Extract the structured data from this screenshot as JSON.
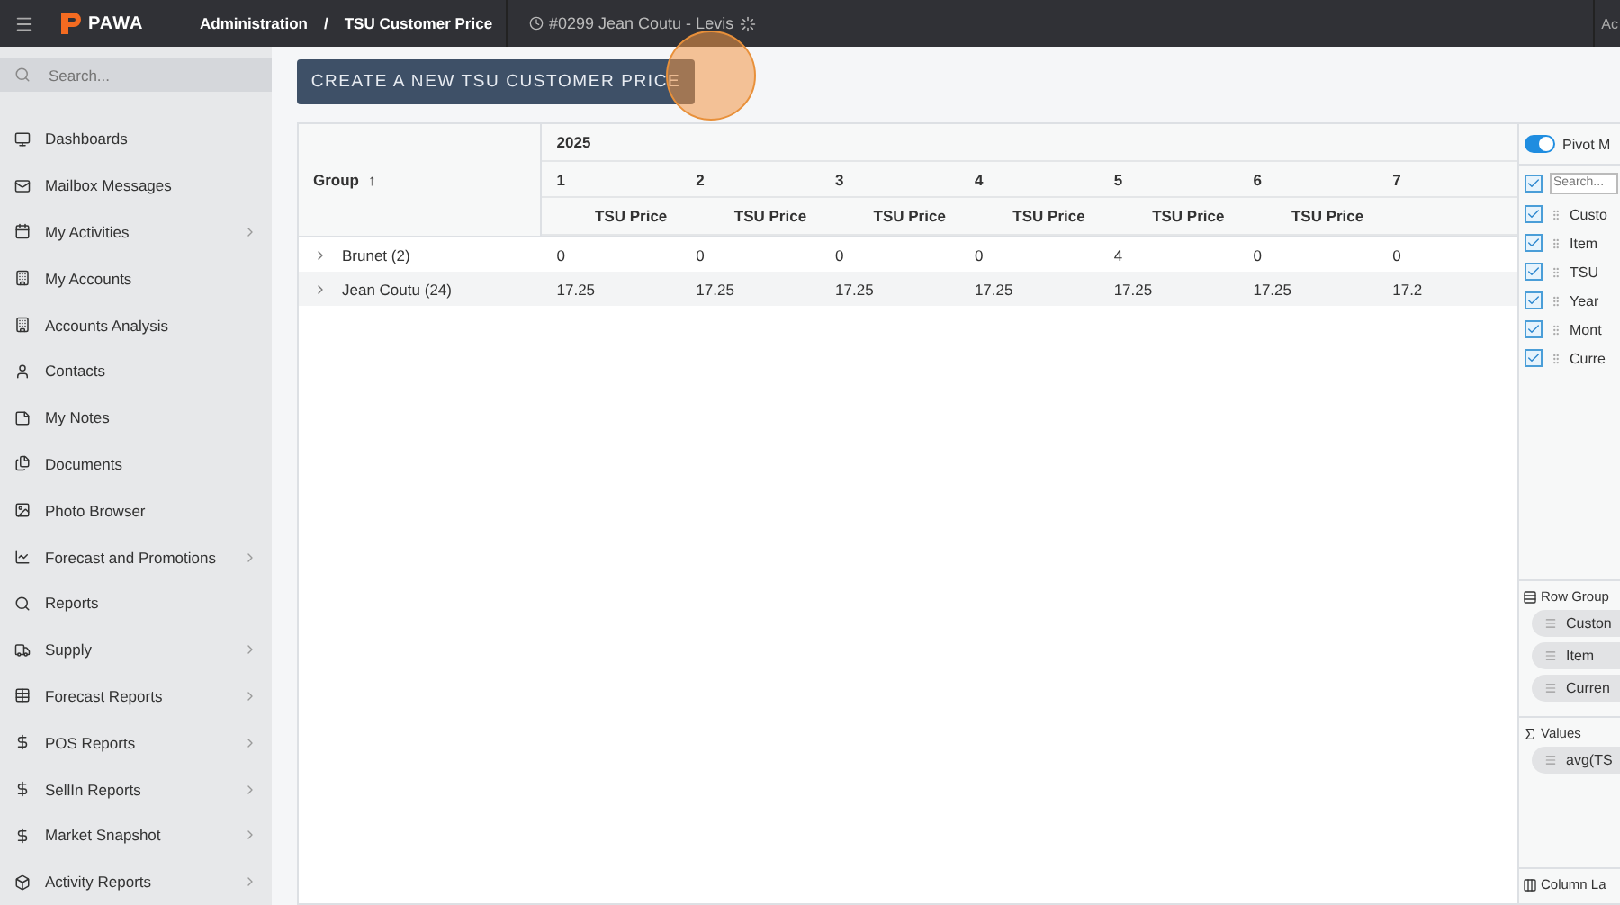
{
  "topbar": {
    "logo": "PAWA",
    "breadcrumb": [
      "Administration",
      "/",
      "TSU Customer Price"
    ],
    "context": "#0299 Jean Coutu - Levis",
    "user": "Ac"
  },
  "sidebar": {
    "search": {
      "placeholder": "Search..."
    },
    "items": [
      {
        "label": "Dashboards",
        "has_submenu": false
      },
      {
        "label": "Mailbox Messages",
        "has_submenu": false
      },
      {
        "label": "My Activities",
        "has_submenu": true
      },
      {
        "label": "My Accounts",
        "has_submenu": false
      },
      {
        "label": "Accounts Analysis",
        "has_submenu": false
      },
      {
        "label": "Contacts",
        "has_submenu": false
      },
      {
        "label": "My Notes",
        "has_submenu": false
      },
      {
        "label": "Documents",
        "has_submenu": false
      },
      {
        "label": "Photo Browser",
        "has_submenu": false
      },
      {
        "label": "Forecast and Promotions",
        "has_submenu": true
      },
      {
        "label": "Reports",
        "has_submenu": false
      },
      {
        "label": "Supply",
        "has_submenu": true
      },
      {
        "label": "Forecast Reports",
        "has_submenu": true
      },
      {
        "label": "POS Reports",
        "has_submenu": true
      },
      {
        "label": "SellIn Reports",
        "has_submenu": true
      },
      {
        "label": "Market Snapshot",
        "has_submenu": true
      },
      {
        "label": "Activity Reports",
        "has_submenu": true
      }
    ]
  },
  "create_button": "CREATE A NEW TSU CUSTOMER PRICE",
  "grid": {
    "group_header": "Group",
    "sort": "↑",
    "year": "2025",
    "columns": [
      {
        "month": "1",
        "measure": "TSU Price"
      },
      {
        "month": "2",
        "measure": "TSU Price"
      },
      {
        "month": "3",
        "measure": "TSU Price"
      },
      {
        "month": "4",
        "measure": "TSU Price"
      },
      {
        "month": "5",
        "measure": "TSU Price"
      },
      {
        "month": "6",
        "measure": "TSU Price"
      },
      {
        "month": "7"
      }
    ],
    "rows": [
      {
        "group": "Brunet",
        "count": "(2)",
        "expanded": false,
        "values": [
          "0",
          "0",
          "0",
          "0",
          "4",
          "0",
          "0"
        ]
      },
      {
        "group": "Jean Coutu",
        "count": "(24)",
        "expanded": false,
        "values": [
          "17.25",
          "17.25",
          "17.25",
          "17.25",
          "17.25",
          "17.25",
          "17.2"
        ]
      }
    ]
  },
  "pivot_panel": {
    "pivot_mode": {
      "label": "Pivot M",
      "on": true
    },
    "search": {
      "placeholder": "Search...",
      "checked": true
    },
    "columns": [
      {
        "label": "Custo",
        "checked": true
      },
      {
        "label": "Item",
        "checked": true
      },
      {
        "label": "TSU",
        "checked": true
      },
      {
        "label": "Year",
        "checked": true
      },
      {
        "label": "Mont",
        "checked": true
      },
      {
        "label": "Curre",
        "checked": true
      }
    ],
    "row_groups": {
      "title": "Row Group",
      "chips": [
        "Custon",
        "Item",
        "Curren"
      ]
    },
    "values": {
      "title": "Values",
      "chips": [
        "avg(TS"
      ]
    },
    "column_labels": {
      "title": "Column La"
    }
  }
}
